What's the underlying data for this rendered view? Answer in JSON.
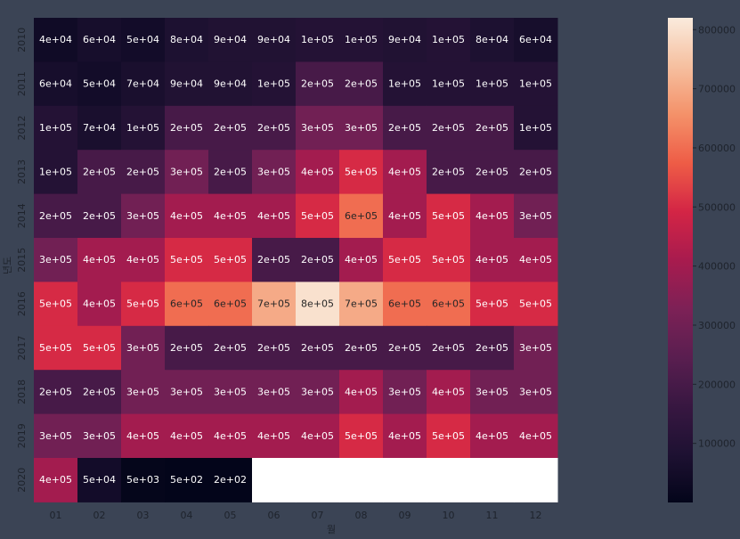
{
  "chart_data": {
    "type": "heatmap",
    "xlabel": "월",
    "ylabel": "년도",
    "x": [
      "01",
      "02",
      "03",
      "04",
      "05",
      "06",
      "07",
      "08",
      "09",
      "10",
      "11",
      "12"
    ],
    "y": [
      "2010",
      "2011",
      "2012",
      "2013",
      "2014",
      "2015",
      "2016",
      "2017",
      "2018",
      "2019",
      "2020"
    ],
    "values": [
      [
        40000,
        60000,
        50000,
        80000,
        90000,
        90000,
        100000,
        100000,
        90000,
        100000,
        80000,
        60000
      ],
      [
        60000,
        50000,
        70000,
        90000,
        90000,
        100000,
        200000,
        200000,
        100000,
        100000,
        100000,
        100000
      ],
      [
        100000,
        70000,
        100000,
        200000,
        200000,
        200000,
        300000,
        300000,
        200000,
        200000,
        200000,
        100000
      ],
      [
        100000,
        200000,
        200000,
        300000,
        200000,
        300000,
        400000,
        500000,
        400000,
        200000,
        200000,
        200000
      ],
      [
        200000,
        200000,
        300000,
        400000,
        400000,
        400000,
        500000,
        600000,
        400000,
        500000,
        400000,
        300000
      ],
      [
        300000,
        400000,
        400000,
        500000,
        500000,
        200000,
        200000,
        400000,
        500000,
        500000,
        400000,
        400000
      ],
      [
        500000,
        400000,
        500000,
        600000,
        600000,
        700000,
        800000,
        700000,
        600000,
        600000,
        500000,
        500000
      ],
      [
        500000,
        500000,
        300000,
        200000,
        200000,
        200000,
        200000,
        200000,
        200000,
        200000,
        200000,
        300000
      ],
      [
        200000,
        200000,
        300000,
        300000,
        300000,
        300000,
        300000,
        400000,
        300000,
        400000,
        300000,
        300000
      ],
      [
        300000,
        300000,
        400000,
        400000,
        400000,
        400000,
        400000,
        500000,
        400000,
        500000,
        400000,
        400000
      ],
      [
        400000,
        50000,
        5000,
        500,
        200,
        null,
        null,
        null,
        null,
        null,
        null,
        null
      ]
    ],
    "labels": [
      [
        "4e+04",
        "6e+04",
        "5e+04",
        "8e+04",
        "9e+04",
        "9e+04",
        "1e+05",
        "1e+05",
        "9e+04",
        "1e+05",
        "8e+04",
        "6e+04"
      ],
      [
        "6e+04",
        "5e+04",
        "7e+04",
        "9e+04",
        "9e+04",
        "1e+05",
        "2e+05",
        "2e+05",
        "1e+05",
        "1e+05",
        "1e+05",
        "1e+05"
      ],
      [
        "1e+05",
        "7e+04",
        "1e+05",
        "2e+05",
        "2e+05",
        "2e+05",
        "3e+05",
        "3e+05",
        "2e+05",
        "2e+05",
        "2e+05",
        "1e+05"
      ],
      [
        "1e+05",
        "2e+05",
        "2e+05",
        "3e+05",
        "2e+05",
        "3e+05",
        "4e+05",
        "5e+05",
        "4e+05",
        "2e+05",
        "2e+05",
        "2e+05"
      ],
      [
        "2e+05",
        "2e+05",
        "3e+05",
        "4e+05",
        "4e+05",
        "4e+05",
        "5e+05",
        "6e+05",
        "4e+05",
        "5e+05",
        "4e+05",
        "3e+05"
      ],
      [
        "3e+05",
        "4e+05",
        "4e+05",
        "5e+05",
        "5e+05",
        "2e+05",
        "2e+05",
        "4e+05",
        "5e+05",
        "5e+05",
        "4e+05",
        "4e+05"
      ],
      [
        "5e+05",
        "4e+05",
        "5e+05",
        "6e+05",
        "6e+05",
        "7e+05",
        "8e+05",
        "7e+05",
        "6e+05",
        "6e+05",
        "5e+05",
        "5e+05"
      ],
      [
        "5e+05",
        "5e+05",
        "3e+05",
        "2e+05",
        "2e+05",
        "2e+05",
        "2e+05",
        "2e+05",
        "2e+05",
        "2e+05",
        "2e+05",
        "3e+05"
      ],
      [
        "2e+05",
        "2e+05",
        "3e+05",
        "3e+05",
        "3e+05",
        "3e+05",
        "3e+05",
        "4e+05",
        "3e+05",
        "4e+05",
        "3e+05",
        "3e+05"
      ],
      [
        "3e+05",
        "3e+05",
        "4e+05",
        "4e+05",
        "4e+05",
        "4e+05",
        "4e+05",
        "5e+05",
        "4e+05",
        "5e+05",
        "4e+05",
        "4e+05"
      ],
      [
        "4e+05",
        "5e+04",
        "5e+03",
        "5e+02",
        "2e+02",
        "",
        "",
        "",
        "",
        "",
        "",
        ""
      ]
    ],
    "colorbar": {
      "min": 0,
      "max": 820000,
      "ticks": [
        100000,
        200000,
        300000,
        400000,
        500000,
        600000,
        700000,
        800000
      ],
      "tick_labels": [
        "100000",
        "200000",
        "300000",
        "400000",
        "500000",
        "600000",
        "700000",
        "800000"
      ]
    },
    "colormap": "rocket",
    "missing_color": "#ffffff"
  }
}
